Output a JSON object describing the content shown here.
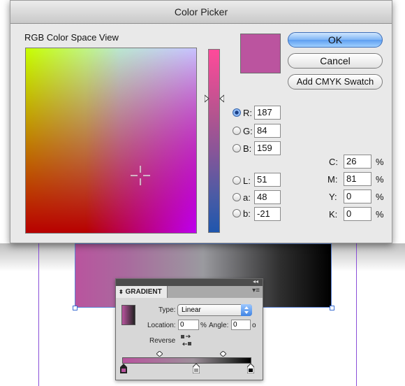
{
  "window": {
    "title": "Color Picker"
  },
  "picker": {
    "space_label": "RGB Color Space View",
    "current_color": "#bb549f",
    "buttons": {
      "ok": "OK",
      "cancel": "Cancel",
      "add_cmyk": "Add CMYK Swatch"
    },
    "rgb": [
      {
        "label": "R:",
        "value": "187",
        "selected": true
      },
      {
        "label": "G:",
        "value": "84",
        "selected": false
      },
      {
        "label": "B:",
        "value": "159",
        "selected": false
      }
    ],
    "lab": [
      {
        "label": "L:",
        "value": "51",
        "selected": false
      },
      {
        "label": "a:",
        "value": "48",
        "selected": false
      },
      {
        "label": "b:",
        "value": "-21",
        "selected": false
      }
    ],
    "cmyk": [
      {
        "label": "C:",
        "value": "26",
        "unit": "%"
      },
      {
        "label": "M:",
        "value": "81",
        "unit": "%"
      },
      {
        "label": "Y:",
        "value": "0",
        "unit": "%"
      },
      {
        "label": "K:",
        "value": "0",
        "unit": "%"
      }
    ]
  },
  "gradient_panel": {
    "tab": "GRADIENT",
    "collapse_glyph": "◂◂",
    "menu_glyph": "▾≡",
    "type_label": "Type:",
    "type_value": "Linear",
    "location_label": "Location:",
    "location_value": "0",
    "location_unit": "%",
    "angle_label": "Angle:",
    "angle_value": "0",
    "angle_unit": "o",
    "reverse_label": "Reverse"
  },
  "colors": {
    "accent": "#5e9ef0",
    "gradient_start": "#b9549e",
    "gradient_end": "#000000",
    "guide": "#8a4fd8"
  }
}
